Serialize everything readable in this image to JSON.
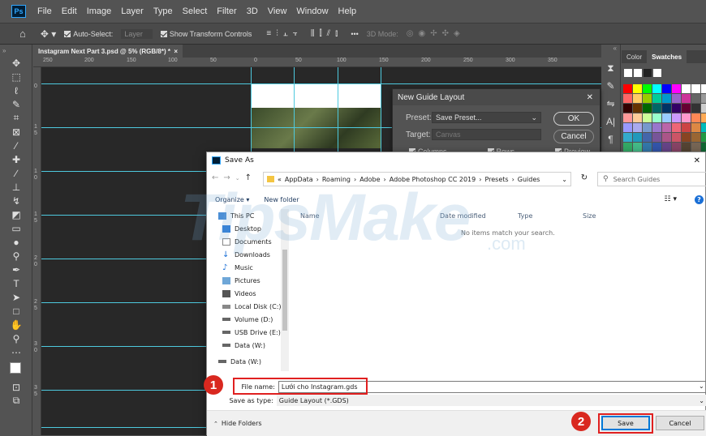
{
  "menubar": {
    "logo": "Ps",
    "items": [
      "File",
      "Edit",
      "Image",
      "Layer",
      "Type",
      "Select",
      "Filter",
      "3D",
      "View",
      "Window",
      "Help"
    ]
  },
  "options": {
    "auto_select": "Auto-Select:",
    "layer_select": "Layer",
    "show_transform": "Show Transform Controls",
    "mode_3d": "3D Mode:",
    "more": "•••"
  },
  "document": {
    "tab_title": "Instagram Next Part 3.psd @ 5% (RGB/8*) *",
    "tab_close": "×",
    "ruler_top": [
      "250",
      "200",
      "150",
      "100",
      "50",
      "0",
      "50",
      "100",
      "150",
      "200",
      "250",
      "300",
      "350"
    ],
    "ruler_left": [
      "0",
      "1",
      "5",
      "1",
      "0",
      "1",
      "5",
      "2",
      "0",
      "2",
      "5",
      "3",
      "0",
      "3",
      "5"
    ]
  },
  "panels": {
    "tab_color": "Color",
    "tab_swatches": "Swatches",
    "swatch_colors": [
      "#ffffff",
      "#ffffff",
      "#000000",
      "#000000",
      "#ffffff",
      "#ffffff",
      "#ffffff",
      "#ffffff",
      "#ffffff",
      "#ff0000",
      "#ffff00",
      "#00ff00",
      "#00ffff",
      "#0000ff",
      "#ff00ff",
      "#ffffff",
      "#ffffff",
      "#ffffff",
      "#ff6666",
      "#ffcc66",
      "#99cc00",
      "#00cc99",
      "#0099cc",
      "#9966cc",
      "#cc3399",
      "#666666",
      "#999999",
      "#330000",
      "#663300",
      "#006600",
      "#006666",
      "#003366",
      "#330066",
      "#660033",
      "#333333",
      "#cccccc",
      "#ff9999",
      "#ffcc99",
      "#ccff99",
      "#99ffcc",
      "#99ccff",
      "#cc99ff",
      "#ff99cc",
      "#ff8855",
      "#ffaa55",
      "#9999ff",
      "#aaaaee",
      "#7799cc",
      "#9977cc",
      "#bb66aa",
      "#ee6677",
      "#cc4444",
      "#dd8844",
      "#00bbbb",
      "#33aacc",
      "#2299bb",
      "#4466aa",
      "#775599",
      "#aa5588",
      "#cc5566",
      "#884422",
      "#996633",
      "#229944",
      "#33aa66",
      "#44bb88",
      "#3377aa",
      "#3355aa",
      "#664488",
      "#884466",
      "#554433",
      "#776655",
      "#116633",
      "#228855",
      "#339977",
      "#225588",
      "#223377",
      "#442266",
      "#552244",
      "#332211",
      "#443322"
    ]
  },
  "guide_dialog": {
    "title": "New Guide Layout",
    "close": "✕",
    "preset_label": "Preset:",
    "preset_value": "Save Preset...",
    "target_label": "Target:",
    "target_value": "Canvas",
    "columns_label": "Columns",
    "rows_label": "Rows",
    "preview_label": "Preview",
    "ok": "OK",
    "cancel": "Cancel"
  },
  "save_dialog": {
    "title": "Save As",
    "breadcrumb": [
      "AppData",
      "Roaming",
      "Adobe",
      "Adobe Photoshop CC 2019",
      "Presets",
      "Guides"
    ],
    "search_placeholder": "Search Guides",
    "organize": "Organize ▾",
    "new_folder": "New folder",
    "nav_items": [
      "This PC",
      "Desktop",
      "Documents",
      "Downloads",
      "Music",
      "Pictures",
      "Videos",
      "Local Disk (C:)",
      "Volume (D:)",
      "USB Drive (E:)",
      "Data (W:)",
      "Data (W:)"
    ],
    "columns": [
      "Name",
      "Date modified",
      "Type",
      "Size"
    ],
    "empty_message": "No items match your search.",
    "file_name_label": "File name:",
    "file_name_value": "Lưới cho Instagram.gds",
    "save_type_label": "Save as type:",
    "save_type_value": "Guide Layout (*.GDS)",
    "hide_folders": "Hide Folders",
    "save": "Save",
    "cancel": "Cancel"
  },
  "annotations": {
    "badge1": "1",
    "badge2": "2"
  },
  "watermark": {
    "main": "TipsMake",
    "suffix": ".com"
  }
}
